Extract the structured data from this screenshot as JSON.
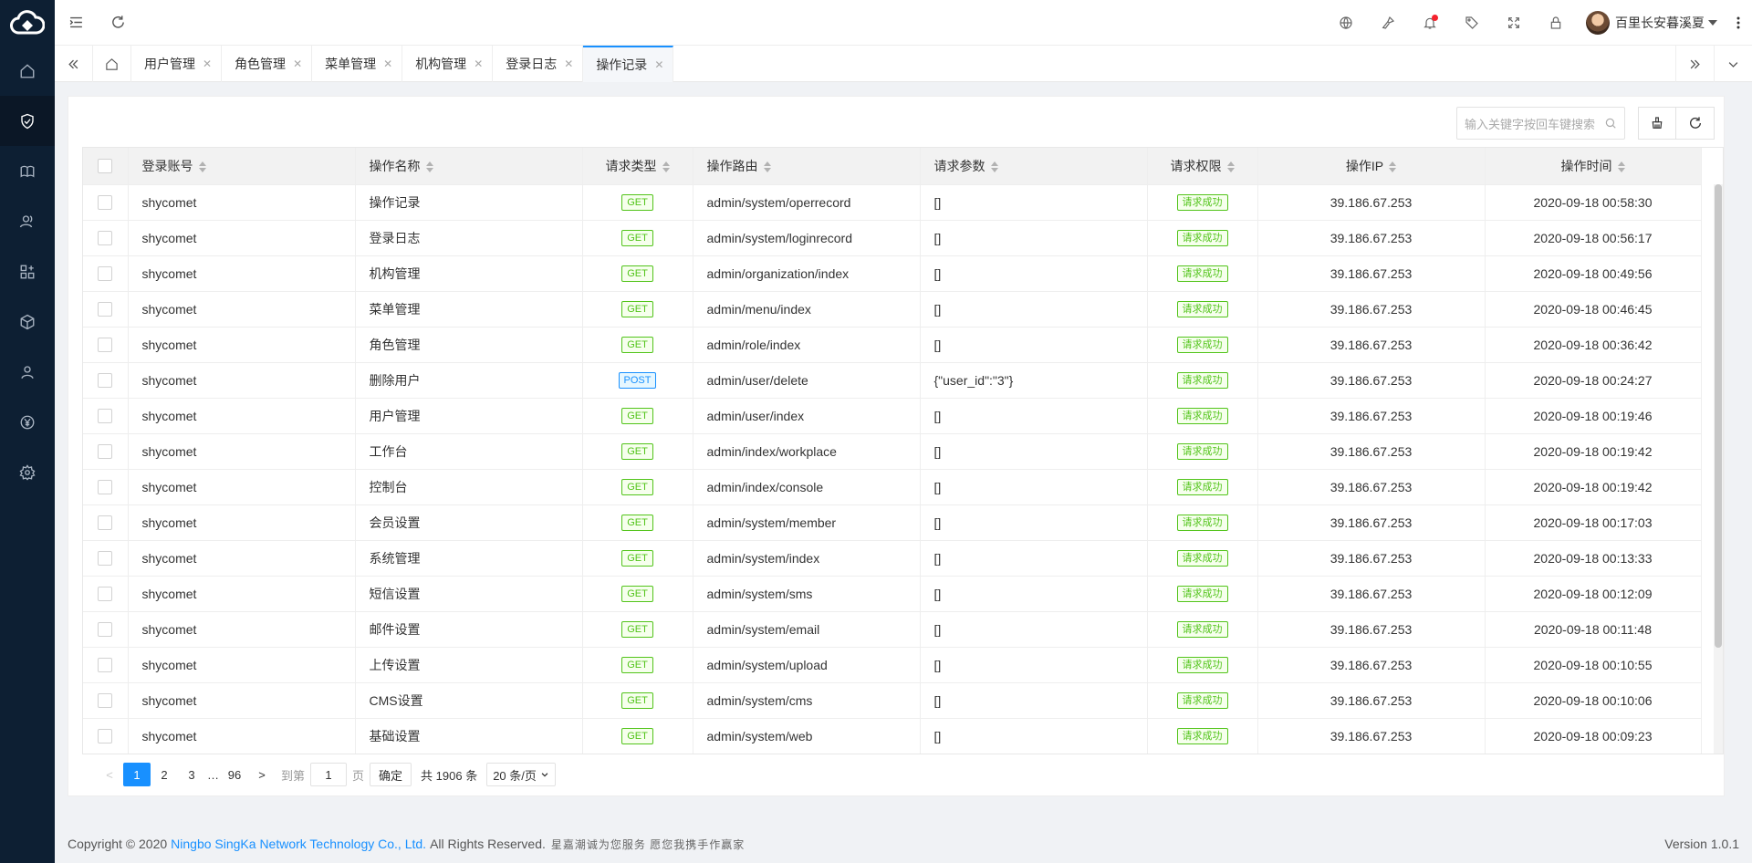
{
  "header": {
    "user_name": "百里长安暮溪夏"
  },
  "tabs": [
    {
      "label": "用户管理"
    },
    {
      "label": "角色管理"
    },
    {
      "label": "菜单管理"
    },
    {
      "label": "机构管理"
    },
    {
      "label": "登录日志"
    },
    {
      "label": "操作记录"
    }
  ],
  "toolbar": {
    "search_placeholder": "输入关键字按回车键搜索"
  },
  "table": {
    "columns": [
      "登录账号",
      "操作名称",
      "请求类型",
      "操作路由",
      "请求参数",
      "请求权限",
      "操作IP",
      "操作时间"
    ],
    "rows": [
      {
        "account": "shycomet",
        "name": "操作记录",
        "method": "GET",
        "route": "admin/system/operrecord",
        "params": "[]",
        "perm": "请求成功",
        "ip": "39.186.67.253",
        "time": "2020-09-18 00:58:30"
      },
      {
        "account": "shycomet",
        "name": "登录日志",
        "method": "GET",
        "route": "admin/system/loginrecord",
        "params": "[]",
        "perm": "请求成功",
        "ip": "39.186.67.253",
        "time": "2020-09-18 00:56:17"
      },
      {
        "account": "shycomet",
        "name": "机构管理",
        "method": "GET",
        "route": "admin/organization/index",
        "params": "[]",
        "perm": "请求成功",
        "ip": "39.186.67.253",
        "time": "2020-09-18 00:49:56"
      },
      {
        "account": "shycomet",
        "name": "菜单管理",
        "method": "GET",
        "route": "admin/menu/index",
        "params": "[]",
        "perm": "请求成功",
        "ip": "39.186.67.253",
        "time": "2020-09-18 00:46:45"
      },
      {
        "account": "shycomet",
        "name": "角色管理",
        "method": "GET",
        "route": "admin/role/index",
        "params": "[]",
        "perm": "请求成功",
        "ip": "39.186.67.253",
        "time": "2020-09-18 00:36:42"
      },
      {
        "account": "shycomet",
        "name": "删除用户",
        "method": "POST",
        "route": "admin/user/delete",
        "params": "{\"user_id\":\"3\"}",
        "perm": "请求成功",
        "ip": "39.186.67.253",
        "time": "2020-09-18 00:24:27"
      },
      {
        "account": "shycomet",
        "name": "用户管理",
        "method": "GET",
        "route": "admin/user/index",
        "params": "[]",
        "perm": "请求成功",
        "ip": "39.186.67.253",
        "time": "2020-09-18 00:19:46"
      },
      {
        "account": "shycomet",
        "name": "工作台",
        "method": "GET",
        "route": "admin/index/workplace",
        "params": "[]",
        "perm": "请求成功",
        "ip": "39.186.67.253",
        "time": "2020-09-18 00:19:42"
      },
      {
        "account": "shycomet",
        "name": "控制台",
        "method": "GET",
        "route": "admin/index/console",
        "params": "[]",
        "perm": "请求成功",
        "ip": "39.186.67.253",
        "time": "2020-09-18 00:19:42"
      },
      {
        "account": "shycomet",
        "name": "会员设置",
        "method": "GET",
        "route": "admin/system/member",
        "params": "[]",
        "perm": "请求成功",
        "ip": "39.186.67.253",
        "time": "2020-09-18 00:17:03"
      },
      {
        "account": "shycomet",
        "name": "系统管理",
        "method": "GET",
        "route": "admin/system/index",
        "params": "[]",
        "perm": "请求成功",
        "ip": "39.186.67.253",
        "time": "2020-09-18 00:13:33"
      },
      {
        "account": "shycomet",
        "name": "短信设置",
        "method": "GET",
        "route": "admin/system/sms",
        "params": "[]",
        "perm": "请求成功",
        "ip": "39.186.67.253",
        "time": "2020-09-18 00:12:09"
      },
      {
        "account": "shycomet",
        "name": "邮件设置",
        "method": "GET",
        "route": "admin/system/email",
        "params": "[]",
        "perm": "请求成功",
        "ip": "39.186.67.253",
        "time": "2020-09-18 00:11:48"
      },
      {
        "account": "shycomet",
        "name": "上传设置",
        "method": "GET",
        "route": "admin/system/upload",
        "params": "[]",
        "perm": "请求成功",
        "ip": "39.186.67.253",
        "time": "2020-09-18 00:10:55"
      },
      {
        "account": "shycomet",
        "name": "CMS设置",
        "method": "GET",
        "route": "admin/system/cms",
        "params": "[]",
        "perm": "请求成功",
        "ip": "39.186.67.253",
        "time": "2020-09-18 00:10:06"
      },
      {
        "account": "shycomet",
        "name": "基础设置",
        "method": "GET",
        "route": "admin/system/web",
        "params": "[]",
        "perm": "请求成功",
        "ip": "39.186.67.253",
        "time": "2020-09-18 00:09:23"
      }
    ]
  },
  "pager": {
    "pages": [
      "1",
      "2",
      "3"
    ],
    "ellipsis": "…",
    "last": "96",
    "goto_label": "到第",
    "goto_value": "1",
    "page_unit": "页",
    "confirm": "确定",
    "total": "共 1906 条",
    "page_size": "20 条/页"
  },
  "footer": {
    "copyright": "Copyright © 2020",
    "company": "Ningbo SingKa Network Technology Co., Ltd.",
    "rights": "All Rights Reserved.",
    "slogan": "星嘉潮诚为您服务 愿您我携手作赢家",
    "version": "Version 1.0.1"
  },
  "colors": {
    "sidebar_bg": "#0d1f33",
    "accent": "#1890ff",
    "success": "#52c41a"
  }
}
